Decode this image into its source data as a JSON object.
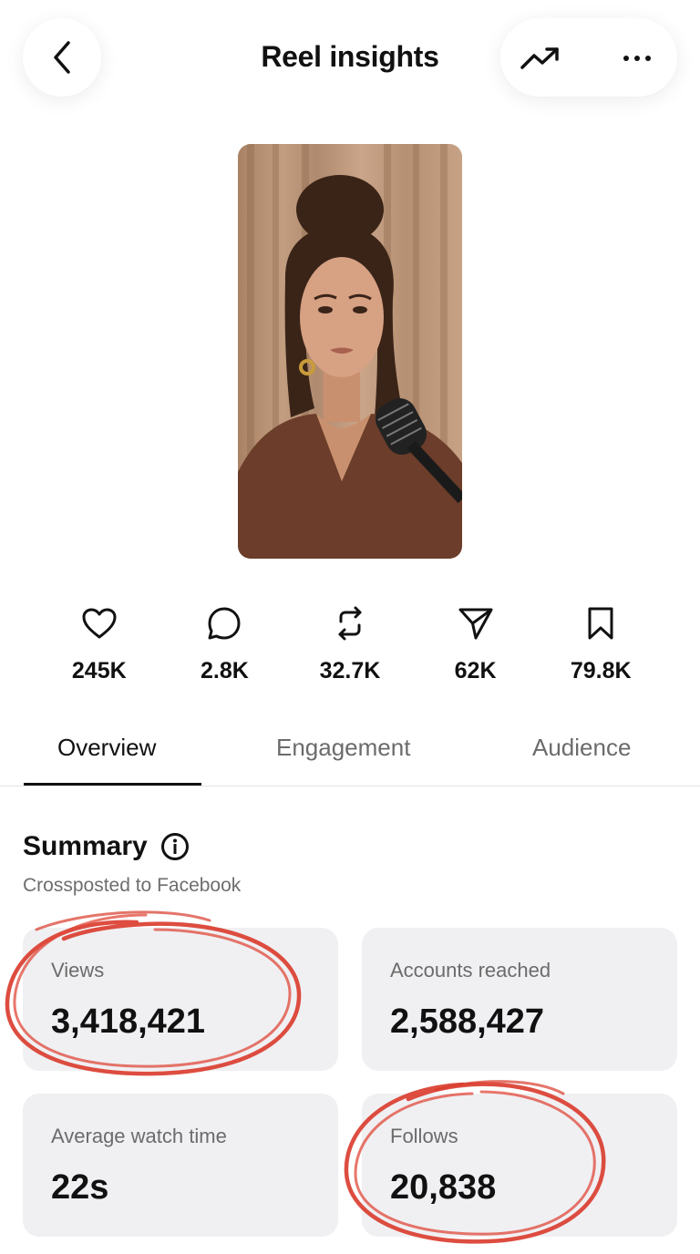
{
  "header": {
    "title": "Reel insights"
  },
  "stats": [
    {
      "icon": "heart-icon",
      "value": "245K"
    },
    {
      "icon": "comment-icon",
      "value": "2.8K"
    },
    {
      "icon": "repost-icon",
      "value": "32.7K"
    },
    {
      "icon": "share-icon",
      "value": "62K"
    },
    {
      "icon": "bookmark-icon",
      "value": "79.8K"
    }
  ],
  "tabs": [
    {
      "label": "Overview",
      "active": true
    },
    {
      "label": "Engagement",
      "active": false
    },
    {
      "label": "Audience",
      "active": false
    }
  ],
  "summary": {
    "title": "Summary",
    "subtitle": "Crossposted to Facebook",
    "cards": [
      {
        "label": "Views",
        "value": "3,418,421"
      },
      {
        "label": "Accounts reached",
        "value": "2,588,427"
      },
      {
        "label": "Average watch time",
        "value": "22s"
      },
      {
        "label": "Follows",
        "value": "20,838"
      }
    ]
  },
  "colors": {
    "card_bg": "#f0f0f3",
    "annotation_red": "#d93a2b",
    "text_primary": "#111111",
    "text_secondary": "#6b6b6b"
  }
}
